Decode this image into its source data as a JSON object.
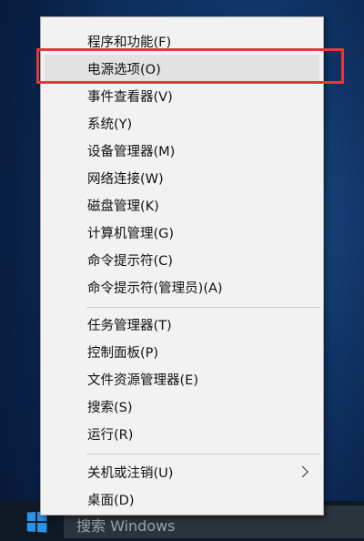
{
  "taskbar": {
    "search_text": "搜索 Windows",
    "start_icon": "windows-logo-icon"
  },
  "menu": {
    "items": [
      {
        "label": "程序和功能(F)",
        "name": "menu-item-programs-features"
      },
      {
        "label": "电源选项(O)",
        "name": "menu-item-power-options",
        "highlighted": true
      },
      {
        "label": "事件查看器(V)",
        "name": "menu-item-event-viewer"
      },
      {
        "label": "系统(Y)",
        "name": "menu-item-system"
      },
      {
        "label": "设备管理器(M)",
        "name": "menu-item-device-manager"
      },
      {
        "label": "网络连接(W)",
        "name": "menu-item-network-connections"
      },
      {
        "label": "磁盘管理(K)",
        "name": "menu-item-disk-management"
      },
      {
        "label": "计算机管理(G)",
        "name": "menu-item-computer-management"
      },
      {
        "label": "命令提示符(C)",
        "name": "menu-item-command-prompt"
      },
      {
        "label": "命令提示符(管理员)(A)",
        "name": "menu-item-command-prompt-admin"
      },
      {
        "label": "任务管理器(T)",
        "name": "menu-item-task-manager"
      },
      {
        "label": "控制面板(P)",
        "name": "menu-item-control-panel"
      },
      {
        "label": "文件资源管理器(E)",
        "name": "menu-item-file-explorer"
      },
      {
        "label": "搜索(S)",
        "name": "menu-item-search"
      },
      {
        "label": "运行(R)",
        "name": "menu-item-run"
      },
      {
        "label": "关机或注销(U)",
        "name": "menu-item-shutdown-signout",
        "has_submenu": true
      },
      {
        "label": "桌面(D)",
        "name": "menu-item-desktop"
      }
    ],
    "submenu_icon": "chevron-right-icon",
    "annotation_color": "#e23a3a"
  }
}
